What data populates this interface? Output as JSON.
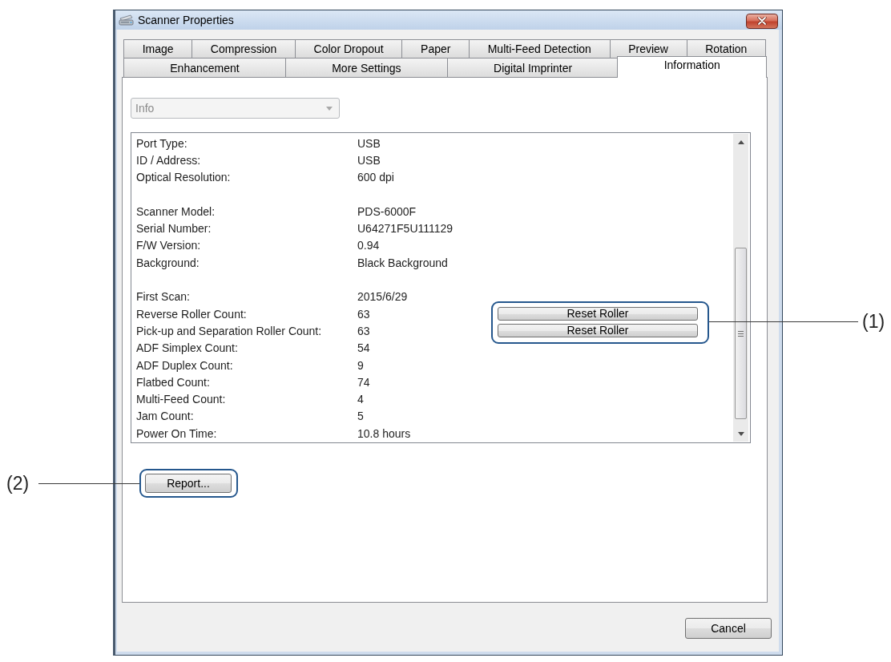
{
  "window": {
    "title": "Scanner Properties"
  },
  "tab_rows": [
    {
      "tabs": [
        {
          "label": "Image",
          "selected": false
        },
        {
          "label": "Compression",
          "selected": false
        },
        {
          "label": "Color Dropout",
          "selected": false
        },
        {
          "label": "Paper",
          "selected": false
        },
        {
          "label": "Multi-Feed Detection",
          "selected": false
        },
        {
          "label": "Preview",
          "selected": false
        },
        {
          "label": "Rotation",
          "selected": false
        }
      ]
    },
    {
      "tabs": [
        {
          "label": "Enhancement",
          "selected": false
        },
        {
          "label": "More Settings",
          "selected": false
        },
        {
          "label": "Digital Imprinter",
          "selected": false
        },
        {
          "label": "Information",
          "selected": true
        }
      ]
    }
  ],
  "dropdown": {
    "value": "Info",
    "disabled": true
  },
  "info_list": {
    "groups": [
      {
        "rows": [
          {
            "label": "Port Type:",
            "value": "USB"
          },
          {
            "label": "ID / Address:",
            "value": "USB"
          },
          {
            "label": "Optical Resolution:",
            "value": "600 dpi"
          }
        ]
      },
      {
        "rows": [
          {
            "label": "Scanner Model:",
            "value": "PDS-6000F"
          },
          {
            "label": "Serial Number:",
            "value": "U64271F5U111129"
          },
          {
            "label": "F/W Version:",
            "value": "0.94"
          },
          {
            "label": "Background:",
            "value": "Black Background"
          }
        ]
      },
      {
        "rows": [
          {
            "label": "First Scan:",
            "value": "2015/6/29"
          },
          {
            "label": "Reverse Roller Count:",
            "value": "63",
            "button": "Reset Roller"
          },
          {
            "label": "Pick-up and Separation Roller Count:",
            "value": "63",
            "button": "Reset Roller"
          },
          {
            "label": "ADF Simplex Count:",
            "value": "54"
          },
          {
            "label": "ADF Duplex Count:",
            "value": "9"
          },
          {
            "label": "Flatbed Count:",
            "value": "74"
          },
          {
            "label": "Multi-Feed Count:",
            "value": "4"
          },
          {
            "label": "Jam Count:",
            "value": "5"
          },
          {
            "label": "Power On Time:",
            "value": "10.8 hours"
          }
        ]
      }
    ]
  },
  "report_button": {
    "label": "Report..."
  },
  "cancel_button": {
    "label": "Cancel"
  },
  "callouts": [
    {
      "label": "(1)"
    },
    {
      "label": "(2)"
    }
  ]
}
